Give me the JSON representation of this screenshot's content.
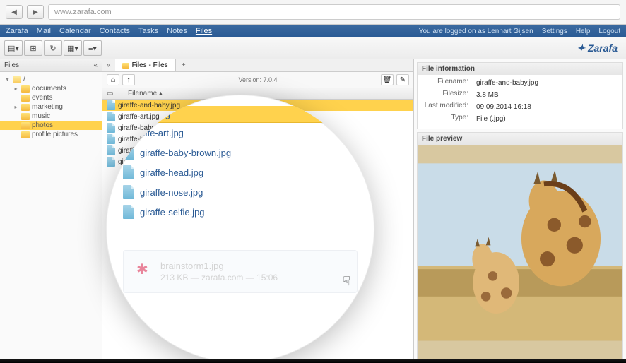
{
  "browser": {
    "url": "www.zarafa.com"
  },
  "menubar": {
    "items": [
      "Zarafa",
      "Mail",
      "Calendar",
      "Contacts",
      "Tasks",
      "Notes",
      "Files"
    ],
    "active_index": 6,
    "logged_in_prefix": "You are logged on as ",
    "user": "Lennart Gijsen",
    "settings": "Settings",
    "help": "Help",
    "logout": "Logout"
  },
  "brand": "Zarafa",
  "sidebar": {
    "title": "Files",
    "tree": [
      {
        "label": "/",
        "depth": 0,
        "open": true
      },
      {
        "label": "documents",
        "depth": 1
      },
      {
        "label": "events",
        "depth": 1
      },
      {
        "label": "marketing",
        "depth": 1
      },
      {
        "label": "music",
        "depth": 1
      },
      {
        "label": "photos",
        "depth": 1,
        "selected": true
      },
      {
        "label": "profile pictures",
        "depth": 1
      }
    ]
  },
  "tab": {
    "label": "Files - Files"
  },
  "file_toolbar": {
    "version": "Version: 7.0.4"
  },
  "columns": {
    "filename": "Filename"
  },
  "files": [
    {
      "name": "giraffe-and-baby.jpg",
      "selected": true
    },
    {
      "name": "giraffe-art.jpg"
    },
    {
      "name": "giraffe-baby-brown.jpg"
    },
    {
      "name": "giraffe-head.jpg"
    },
    {
      "name": "giraffe-nose.jpg"
    },
    {
      "name": "giraffe-selfie.jpg"
    }
  ],
  "magnifier": {
    "selected": "nd-baby.jpg",
    "rows": [
      "affe-art.jpg",
      "giraffe-baby-brown.jpg",
      "giraffe-head.jpg",
      "giraffe-nose.jpg",
      "giraffe-selfie.jpg"
    ],
    "download": {
      "name": "brainstorm1.jpg",
      "meta": "213 KB — zarafa.com — 15:06"
    }
  },
  "details": {
    "info_title": "File information",
    "labels": {
      "filename": "Filename:",
      "filesize": "Filesize:",
      "modified": "Last modified:",
      "type": "Type:"
    },
    "values": {
      "filename": "giraffe-and-baby.jpg",
      "filesize": "3.8 MB",
      "modified": "09.09.2014 16:18",
      "type": "File (.jpg)"
    },
    "preview_title": "File preview"
  }
}
